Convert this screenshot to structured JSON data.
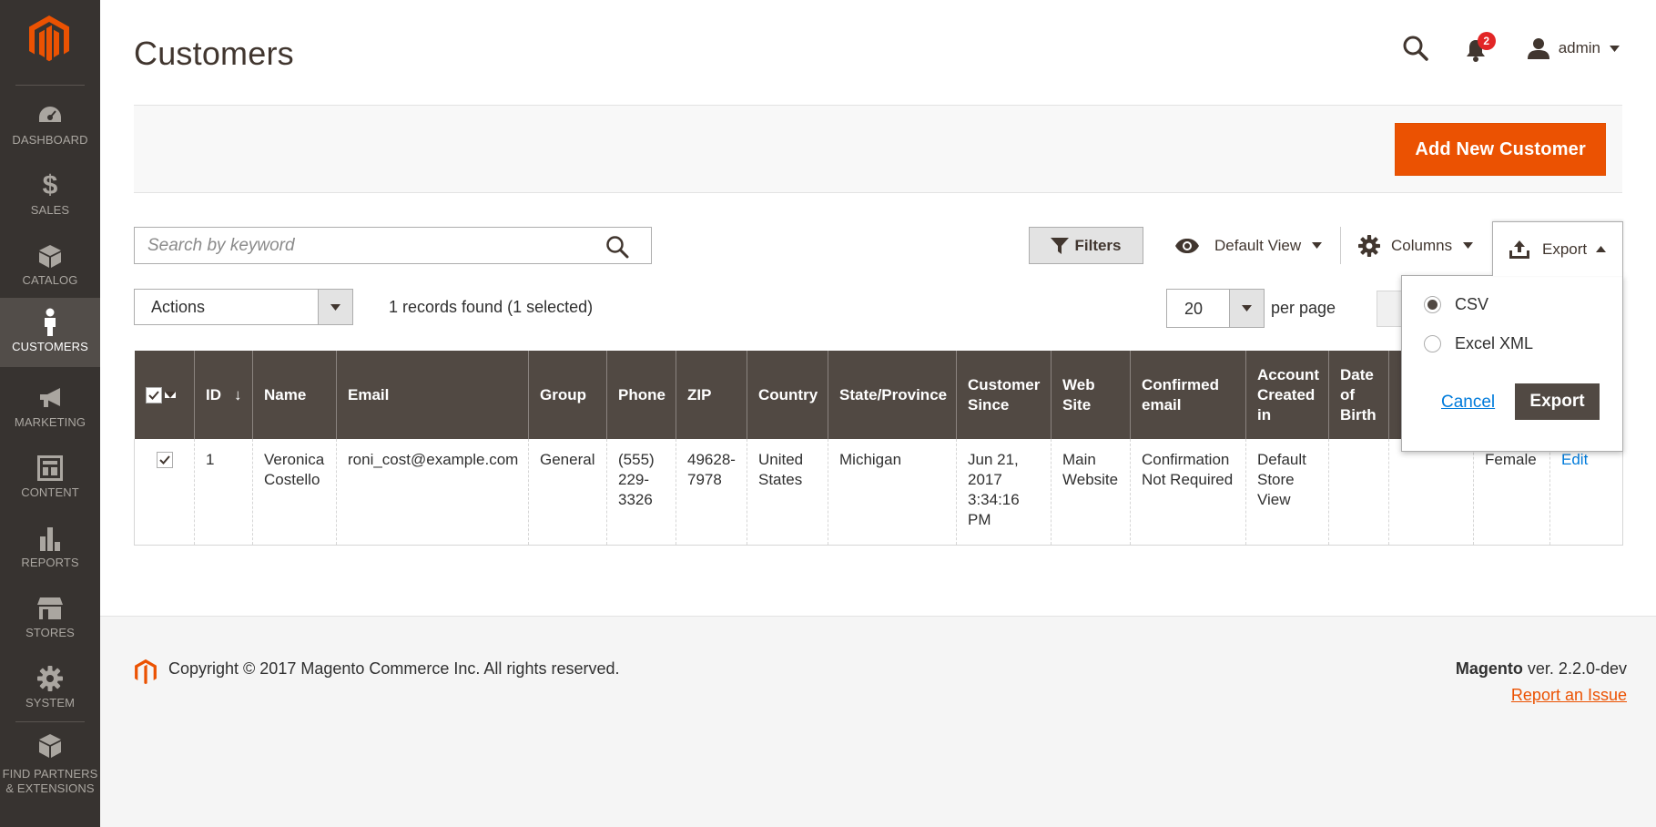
{
  "app": {
    "title": "Customers"
  },
  "sidebar": {
    "items": [
      {
        "label": "Dashboard",
        "icon": "dashboard-icon"
      },
      {
        "label": "Sales",
        "icon": "dollar-icon"
      },
      {
        "label": "Catalog",
        "icon": "box-icon"
      },
      {
        "label": "Customers",
        "icon": "person-icon",
        "active": true
      },
      {
        "label": "Marketing",
        "icon": "megaphone-icon"
      },
      {
        "label": "Content",
        "icon": "layout-icon"
      },
      {
        "label": "Reports",
        "icon": "bar-chart-icon"
      },
      {
        "label": "Stores",
        "icon": "storefront-icon"
      },
      {
        "label": "System",
        "icon": "gear-icon"
      }
    ],
    "partners": {
      "line1": "Find Partners",
      "line2": "& Extensions",
      "icon": "blocks-icon"
    }
  },
  "header": {
    "notifications_count": "2",
    "user_name": "admin"
  },
  "page_actions": {
    "add_button": "Add New Customer"
  },
  "toolbar": {
    "search_placeholder": "Search by keyword",
    "filters_label": "Filters",
    "view_label": "Default View",
    "columns_label": "Columns",
    "export_label": "Export",
    "actions_label": "Actions",
    "records_text": "1 records found (1 selected)",
    "per_page_value": "20",
    "per_page_label": "per page"
  },
  "export_panel": {
    "options": [
      {
        "label": "CSV",
        "checked": true
      },
      {
        "label": "Excel XML",
        "checked": false
      }
    ],
    "cancel_label": "Cancel",
    "export_label": "Export"
  },
  "grid": {
    "columns": [
      "ID",
      "Name",
      "Email",
      "Group",
      "Phone",
      "ZIP",
      "Country",
      "State/Province",
      "Customer Since",
      "Web Site",
      "Confirmed email",
      "Account Created in",
      "Date of Birth",
      "",
      "",
      ""
    ],
    "id_sort_arrow": "↓",
    "rows": [
      {
        "id": "1",
        "name": "Veronica Costello",
        "email": "roni_cost@example.com",
        "group": "General",
        "phone": "(555) 229-3326",
        "zip": "49628-7978",
        "country": "United States",
        "state": "Michigan",
        "customer_since": "Jun 21, 2017 3:34:16 PM",
        "website": "Main Website",
        "confirmed_email": "Confirmation Not Required",
        "account_created_in": "Default Store View",
        "dob": "",
        "tax_vat": "",
        "gender": "Female",
        "action": "Edit"
      }
    ]
  },
  "footer": {
    "copyright": "Copyright © 2017 Magento Commerce Inc. All rights reserved.",
    "brand": "Magento",
    "version": " ver. 2.2.0-dev",
    "report_link": "Report an Issue"
  },
  "colors": {
    "accent": "#eb5202",
    "sidebar_bg": "#373330",
    "grid_header": "#514943",
    "link": "#007bdb"
  }
}
